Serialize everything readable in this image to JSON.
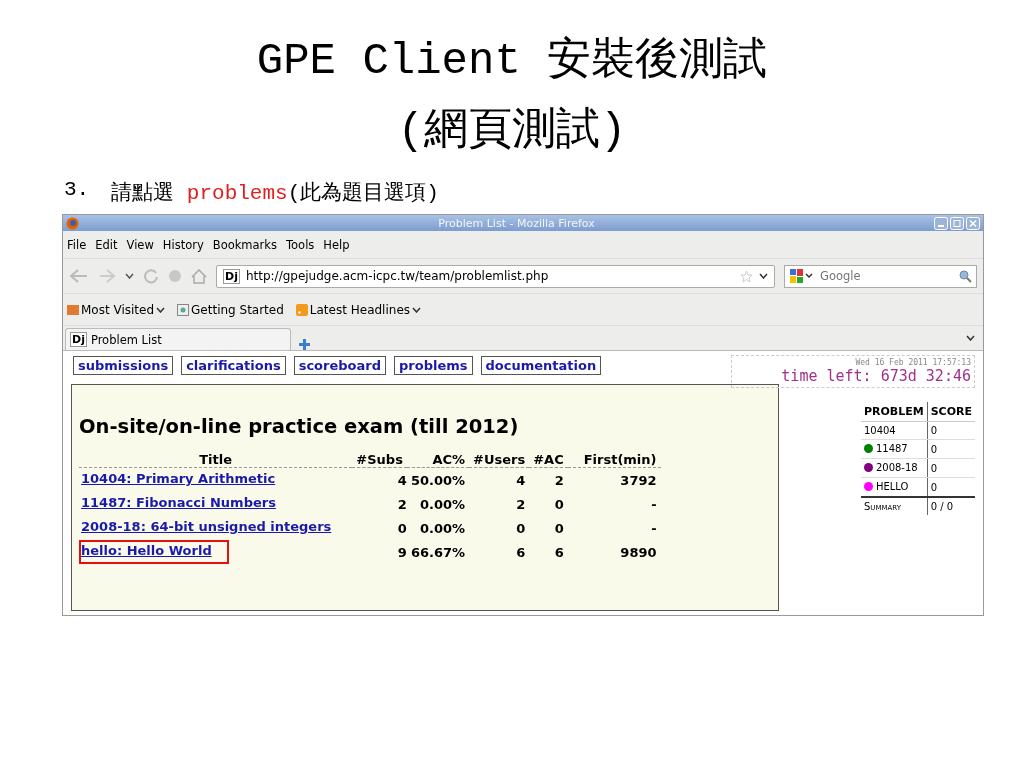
{
  "slide": {
    "title_lines": [
      "GPE Client 安裝後測試",
      "(網頁測試)"
    ],
    "step": {
      "number": "3.",
      "prefix": "請點選",
      "keyword": "problems",
      "suffix": "(此為題目選項)"
    }
  },
  "browser": {
    "window_title": "Problem List - Mozilla Firefox",
    "menu": [
      "File",
      "Edit",
      "View",
      "History",
      "Bookmarks",
      "Tools",
      "Help"
    ],
    "address": {
      "site_icon": "Dj",
      "url": "http://gpejudge.acm-icpc.tw/team/problemlist.php"
    },
    "search": {
      "placeholder": "Google"
    },
    "bookmarks": [
      {
        "kind": "folder",
        "label": "Most Visited",
        "dropdown": true
      },
      {
        "kind": "page",
        "label": "Getting Started",
        "dropdown": false
      },
      {
        "kind": "feed",
        "label": "Latest Headlines",
        "dropdown": true
      }
    ],
    "tabs": [
      {
        "site_icon": "Dj",
        "label": "Problem List",
        "selected": true
      }
    ]
  },
  "page": {
    "nav_links": [
      "submissions",
      "clarifications",
      "scoreboard",
      "problems",
      "documentation"
    ],
    "clock": {
      "date": "Wed 16 Feb 2011 17:57:13",
      "time_left": "time left: 673d 32:46"
    },
    "heading": "On-site/on-line practice exam (till 2012)",
    "columns": [
      "Title",
      "#Subs",
      "AC%",
      "#Users",
      "#AC",
      "First(min)"
    ],
    "rows": [
      {
        "title": "10404: Primary Arithmetic",
        "subs": "4",
        "ac_pct": "50.00%",
        "users": "4",
        "ac": "2",
        "first": "3792",
        "highlighted": false
      },
      {
        "title": "11487: Fibonacci Numbers",
        "subs": "2",
        "ac_pct": "0.00%",
        "users": "2",
        "ac": "0",
        "first": "-",
        "highlighted": false
      },
      {
        "title": "2008-18: 64-bit unsigned integers",
        "subs": "0",
        "ac_pct": "0.00%",
        "users": "0",
        "ac": "0",
        "first": "-",
        "highlighted": false
      },
      {
        "title": "hello: Hello World",
        "subs": "9",
        "ac_pct": "66.67%",
        "users": "6",
        "ac": "6",
        "first": "9890",
        "highlighted": true
      }
    ],
    "score_table": {
      "columns": [
        "PROBLEM",
        "SCORE"
      ],
      "rows": [
        {
          "problem": "10404",
          "score": "0"
        },
        {
          "problem": "11487",
          "score": "0",
          "color": "#008000"
        },
        {
          "problem": "2008-18",
          "score": "0",
          "color": "#800080"
        },
        {
          "problem": "HELLO",
          "score": "0",
          "color": "#ff00ff"
        }
      ],
      "summary": {
        "label": "Summary",
        "score": "0 / 0"
      }
    }
  }
}
